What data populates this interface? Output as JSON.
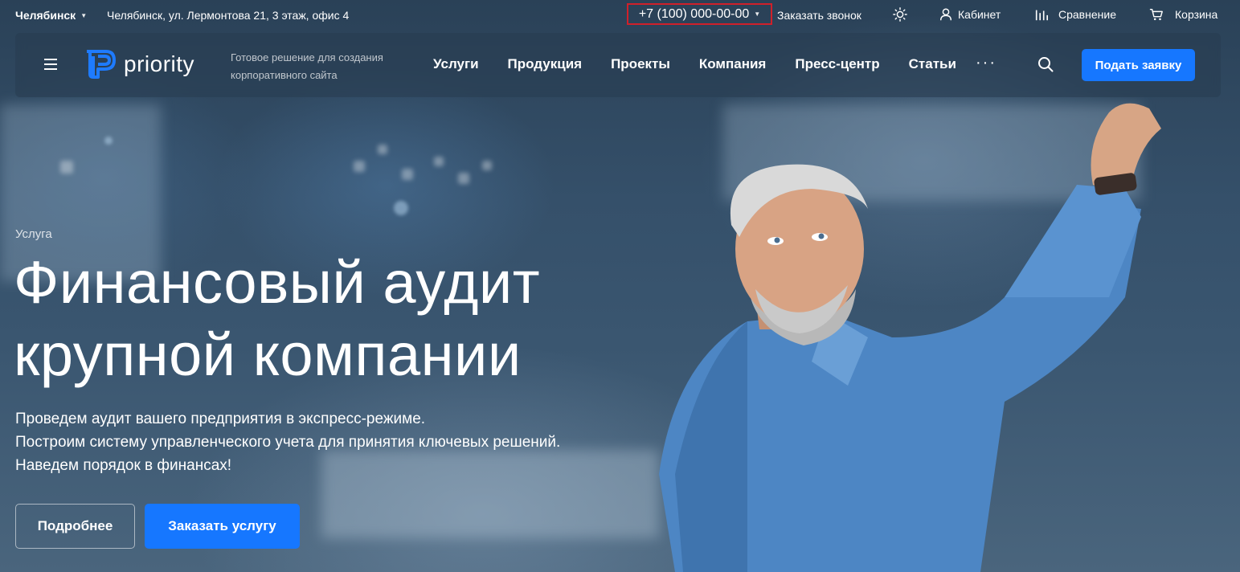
{
  "topbar": {
    "city": "Челябинск",
    "address": "Челябинск, ул. Лермонтова 21, 3 этаж, офис 4",
    "phone": "+7 (100) 000-00-00",
    "callback": "Заказать звонок",
    "cabinet": "Кабинет",
    "compare": "Сравнение",
    "cart": "Корзина"
  },
  "nav": {
    "logo": "priority",
    "tagline": "Готовое решение для создания корпоративного сайта",
    "menu": [
      "Услуги",
      "Продукция",
      "Проекты",
      "Компания",
      "Пресс-центр",
      "Статьи"
    ],
    "more": "···",
    "cta": "Подать заявку"
  },
  "hero": {
    "eyebrow": "Услуга",
    "title_line1": "Финансовый аудит",
    "title_line2": "крупной компании",
    "sub_line1": "Проведем аудит вашего предприятия в экспресс-режиме.",
    "sub_line2": "Построим систему управленческого учета для принятия ключевых решений.",
    "sub_line3": "Наведем порядок в финансах!",
    "btn_more": "Подробнее",
    "btn_order": "Заказать услугу"
  },
  "colors": {
    "accent": "#1677ff",
    "highlight": "#d0202a"
  }
}
